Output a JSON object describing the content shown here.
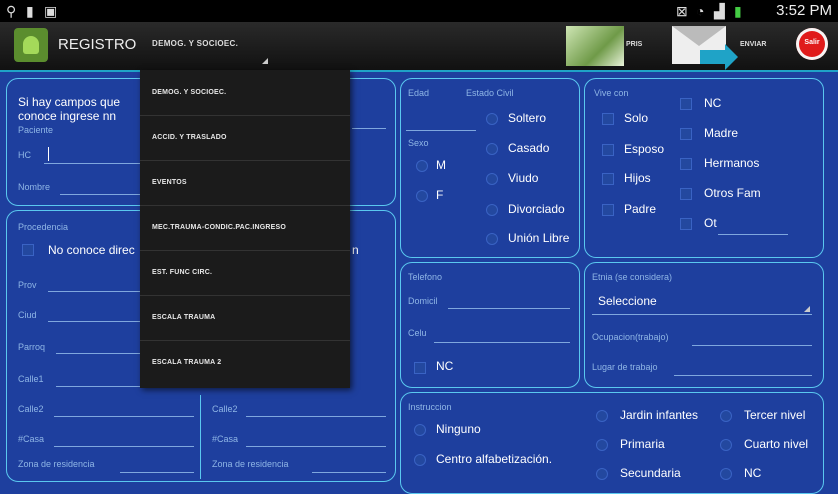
{
  "status_bar": {
    "time": "3:52 PM"
  },
  "action_bar": {
    "title": "REGISTRO",
    "section_selector": "DEMOG. Y SOCIOEC.",
    "pris_label": "PRIS",
    "send_label": "ENVIAR",
    "exit_label": "Salir"
  },
  "dropdown": {
    "items": [
      "DEMOG. Y SOCIOEC.",
      "ACCID. Y TRASLADO",
      "EVENTOS",
      "MEC.TRAUMA-CONDIC.PAC.INGRESO",
      "EST. FUNC CIRC.",
      "ESCALA TRAUMA",
      "ESCALA TRAUMA 2"
    ]
  },
  "patient": {
    "info_line1": "Si hay campos que",
    "info_line2": "conoce ingrese nn",
    "paciente_label": "Paciente",
    "hc_label": "HC",
    "nombre_label": "Nombre"
  },
  "procedencia": {
    "label": "Procedencia",
    "no_conoce": "No conoce direc",
    "trailing": "n",
    "prov": "Prov",
    "ciud": "Ciud",
    "parroq": "Parroq",
    "calle1": "Calle1",
    "calle2": "Calle2",
    "casa": "#Casa",
    "zona": "Zona de residencia",
    "calle2b": "Calle2",
    "casab": "#Casa",
    "zonab": "Zona de residencia"
  },
  "edad": {
    "edad_label": "Edad",
    "estado_civil_label": "Estado Civil",
    "sexo_label": "Sexo",
    "m": "M",
    "f": "F",
    "estado_options": [
      "Soltero",
      "Casado",
      "Viudo",
      "Divorciado",
      "Unión Libre"
    ]
  },
  "vive": {
    "label": "Vive con",
    "col1": [
      "Solo",
      "Esposo",
      "Hijos",
      "Padre"
    ],
    "col2": [
      "NC",
      "Madre",
      "Hermanos",
      "Otros Fam",
      "Ot"
    ]
  },
  "telefono": {
    "label": "Telefono",
    "domicil": "Domicil",
    "celu": "Celu",
    "nc": "NC"
  },
  "etnia": {
    "label": "Etnia (se considera)",
    "value": "Seleccione",
    "ocupacion": "Ocupacion(trabajo)",
    "lugar": "Lugar de trabajo"
  },
  "instruccion": {
    "label": "Instruccion",
    "col1": [
      "Ninguno",
      "Centro alfabetización."
    ],
    "col2": [
      "Jardin infantes",
      "Primaria",
      "Secundaria"
    ],
    "col3": [
      "Tercer nivel",
      "Cuarto nivel",
      "NC"
    ]
  }
}
